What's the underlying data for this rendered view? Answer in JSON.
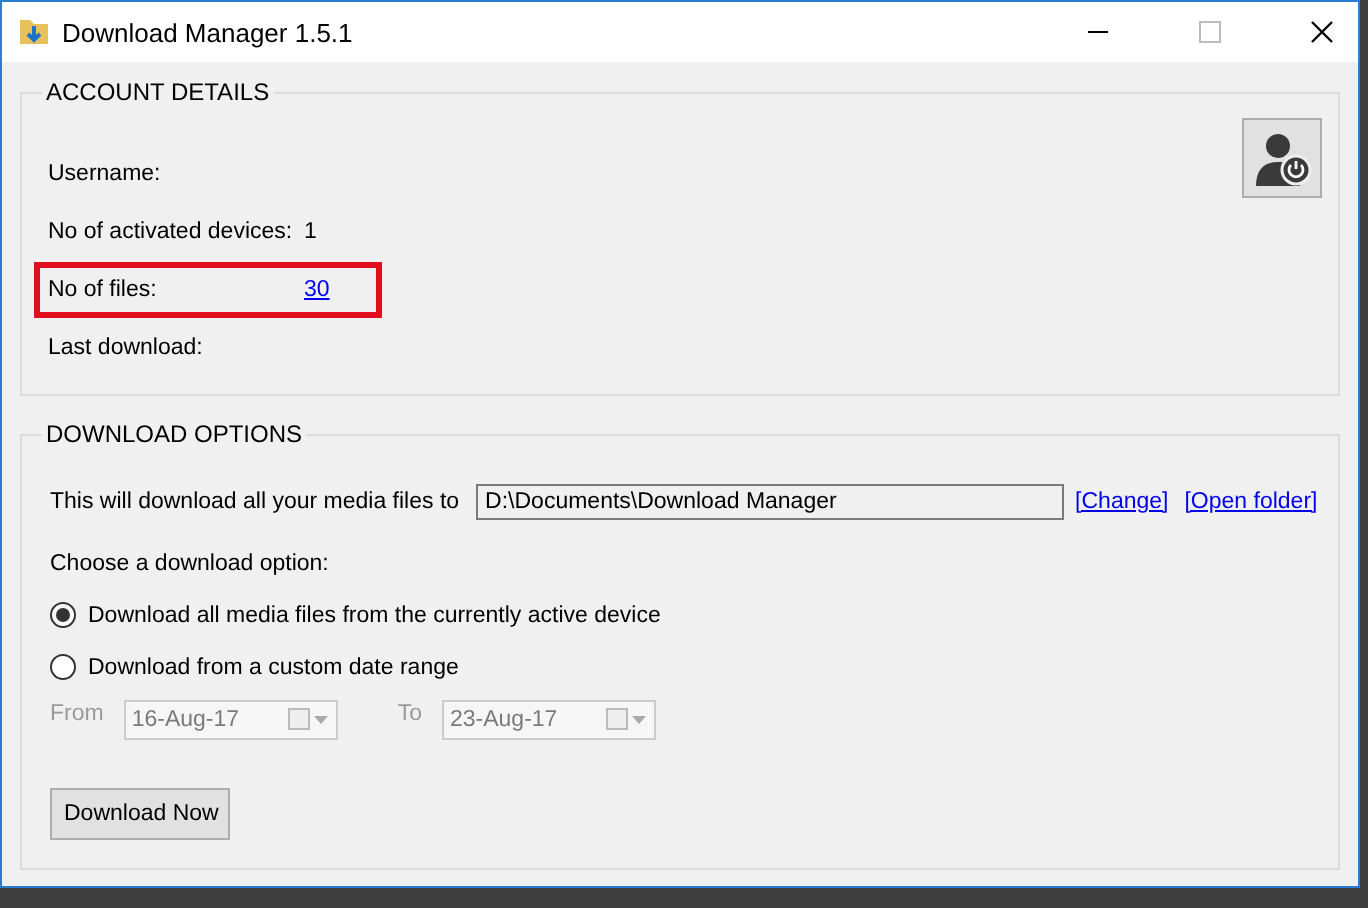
{
  "window": {
    "title": "Download Manager 1.5.1"
  },
  "account_details": {
    "title": "ACCOUNT DETAILS",
    "fields": [
      {
        "label": "Username:",
        "highlighted": false
      },
      {
        "label": "No of activated devices:",
        "value": "1",
        "highlighted": false
      },
      {
        "label": "No of files:",
        "link": "30",
        "highlighted": true
      },
      {
        "label": "Last download:",
        "highlighted": false
      }
    ]
  },
  "download_options": {
    "title": "DOWNLOAD OPTIONS",
    "path_label": "This will download all your media files to",
    "path": "D:\\Documents\\Download Manager",
    "links": [
      "[Change]",
      "[Open folder]"
    ],
    "choose_label": "Choose a download option:",
    "options": [
      {
        "label": "Download all media files from the currently active device",
        "selected": true
      },
      {
        "label": "Download from a custom date range",
        "selected": false
      }
    ],
    "from": {
      "label": "From",
      "value": "16-Aug-17",
      "disabled": true
    },
    "to": {
      "label": "To",
      "value": "23-Aug-17",
      "disabled": true
    },
    "button": "Download Now"
  }
}
